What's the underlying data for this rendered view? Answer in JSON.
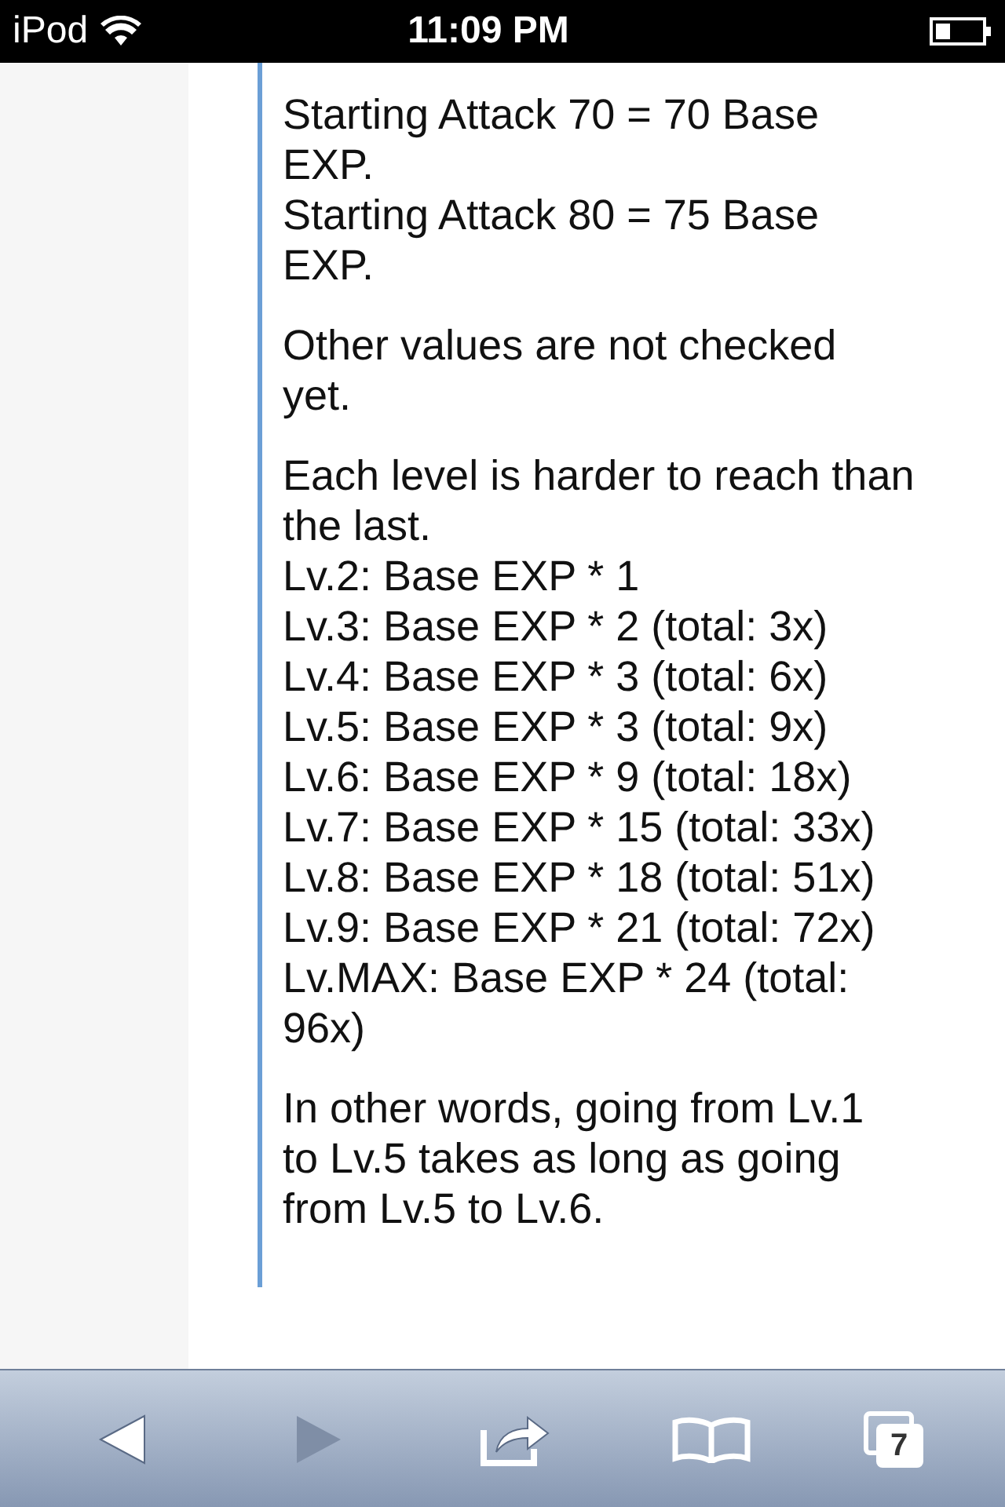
{
  "status_bar": {
    "carrier": "iPod",
    "time": "11:09 PM"
  },
  "paragraphs": [
    {
      "lines": [
        "Starting Attack 70 = 70 Base",
        "EXP.",
        "Starting Attack 80 = 75 Base",
        "EXP."
      ]
    },
    {
      "lines": [
        "Other values are not checked",
        "yet."
      ]
    },
    {
      "lines": [
        "Each level is harder to reach than",
        "the last.",
        "Lv.2: Base EXP * 1",
        "Lv.3: Base EXP * 2 (total: 3x)",
        "Lv.4: Base EXP * 3 (total: 6x)",
        "Lv.5: Base EXP * 3 (total: 9x)",
        "Lv.6: Base EXP * 9 (total: 18x)",
        "Lv.7: Base EXP * 15 (total: 33x)",
        "Lv.8: Base EXP * 18 (total: 51x)",
        "Lv.9: Base EXP * 21 (total: 72x)",
        "Lv.MAX: Base EXP * 24 (total:",
        "96x)"
      ]
    },
    {
      "lines": [
        "In other words, going from Lv.1",
        "to Lv.5 takes as long as going",
        "from Lv.5 to Lv.6."
      ]
    }
  ],
  "toolbar": {
    "back": {
      "disabled": false
    },
    "forward": {
      "disabled": true
    },
    "tab_count": "7"
  }
}
